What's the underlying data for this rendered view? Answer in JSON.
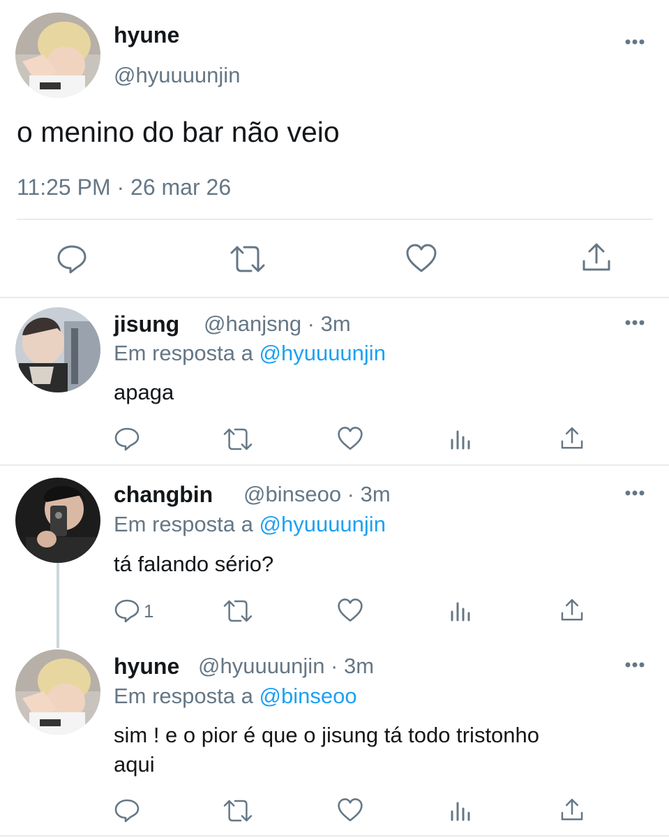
{
  "main_tweet": {
    "display_name": "hyune",
    "handle": "@hyuuuunjin",
    "text": "o menino do bar não veio",
    "timestamp": "11:25 PM · 26 mar 26",
    "avatar_icon": "user-avatar-photo"
  },
  "replies": [
    {
      "display_name": "jisung",
      "meta": "@hanjsng · 3m",
      "reply_prefix": "Em resposta a",
      "reply_to": "@hyuuuunjin",
      "text": "apaga",
      "reply_count": ""
    },
    {
      "display_name": "changbin",
      "meta": "@binseoo · 3m",
      "reply_prefix": "Em resposta a",
      "reply_to": "@hyuuuunjin",
      "text": "tá falando sério?",
      "reply_count": "1"
    },
    {
      "display_name": "hyune",
      "meta": "@hyuuuunjin · 3m",
      "reply_prefix": "Em resposta a",
      "reply_to": "@binseoo",
      "text_line1": "sim ! e o pior é que o jisung tá todo tristonho",
      "text_line2": "aqui",
      "reply_count": ""
    }
  ],
  "colors": {
    "text": "#14171a",
    "secondary": "#657786",
    "link": "#1da1f2",
    "divider": "#e6ecf0"
  }
}
